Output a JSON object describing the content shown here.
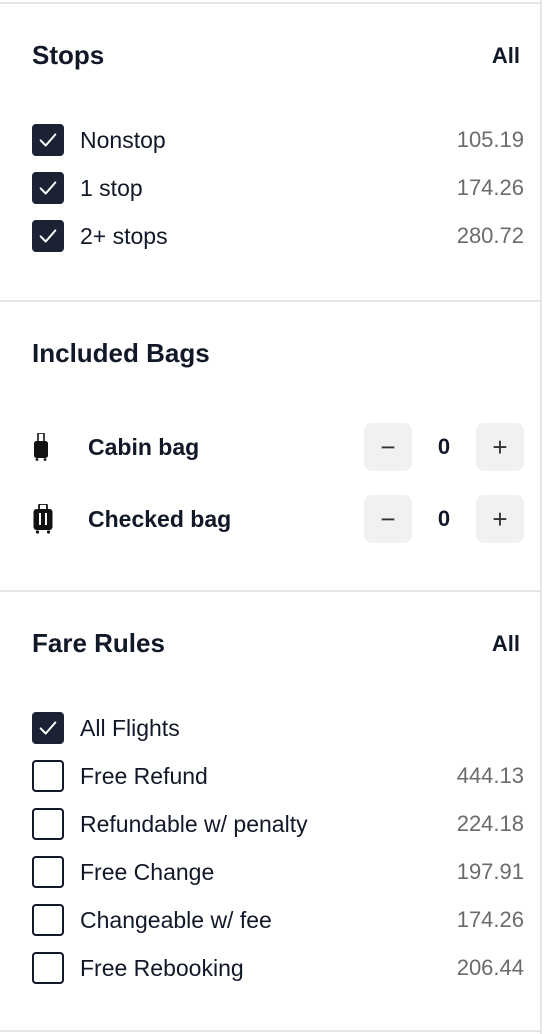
{
  "stops": {
    "title": "Stops",
    "all_label": "All",
    "items": [
      {
        "label": "Nonstop",
        "price": "105.19",
        "checked": true
      },
      {
        "label": "1 stop",
        "price": "174.26",
        "checked": true
      },
      {
        "label": "2+ stops",
        "price": "280.72",
        "checked": true
      }
    ]
  },
  "bags": {
    "title": "Included Bags",
    "items": [
      {
        "label": "Cabin bag",
        "icon": "cabin-bag-icon",
        "minus": "−",
        "value": "0",
        "plus": "+"
      },
      {
        "label": "Checked bag",
        "icon": "checked-bag-icon",
        "minus": "−",
        "value": "0",
        "plus": "+"
      }
    ]
  },
  "fare_rules": {
    "title": "Fare Rules",
    "all_label": "All",
    "items": [
      {
        "label": "All Flights",
        "price": "",
        "checked": true
      },
      {
        "label": "Free Refund",
        "price": "444.13",
        "checked": false
      },
      {
        "label": "Refundable w/ penalty",
        "price": "224.18",
        "checked": false
      },
      {
        "label": "Free Change",
        "price": "197.91",
        "checked": false
      },
      {
        "label": "Changeable w/ fee",
        "price": "174.26",
        "checked": false
      },
      {
        "label": "Free Rebooking",
        "price": "206.44",
        "checked": false
      }
    ]
  },
  "colors": {
    "checkbox_checked": "#1b2233",
    "price_text": "#6b6b6b",
    "stepper_bg": "#f0f1f3",
    "divider": "#e6e6e6"
  }
}
